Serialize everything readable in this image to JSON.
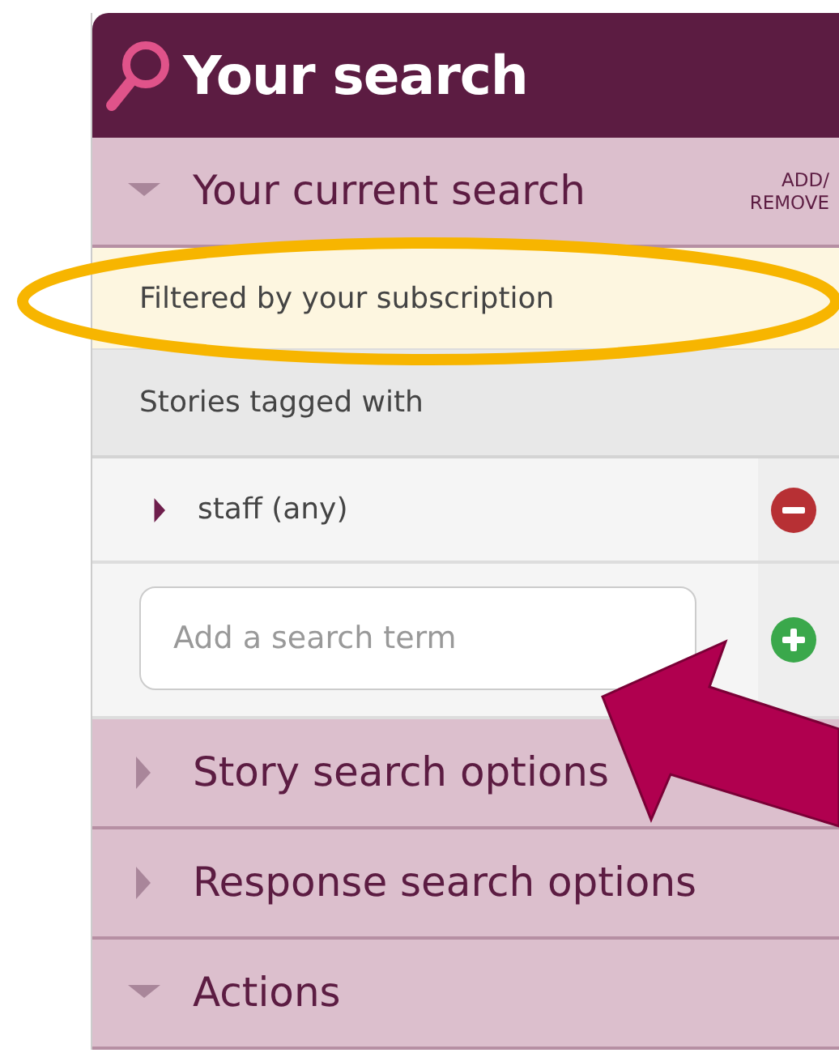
{
  "title": "Your search",
  "current_search": {
    "label": "Your current search",
    "expanded": true,
    "action": "ADD/\nREMOVE",
    "notice": "Filtered by your subscription",
    "group_label": "Stories tagged with",
    "terms": [
      {
        "label": "staff (any)",
        "expanded": false
      }
    ],
    "input": {
      "placeholder": "Add a search term"
    }
  },
  "sections": [
    {
      "label": "Story search options",
      "expanded": false
    },
    {
      "label": "Response search options",
      "expanded": false
    },
    {
      "label": "Actions",
      "expanded": true
    }
  ]
}
